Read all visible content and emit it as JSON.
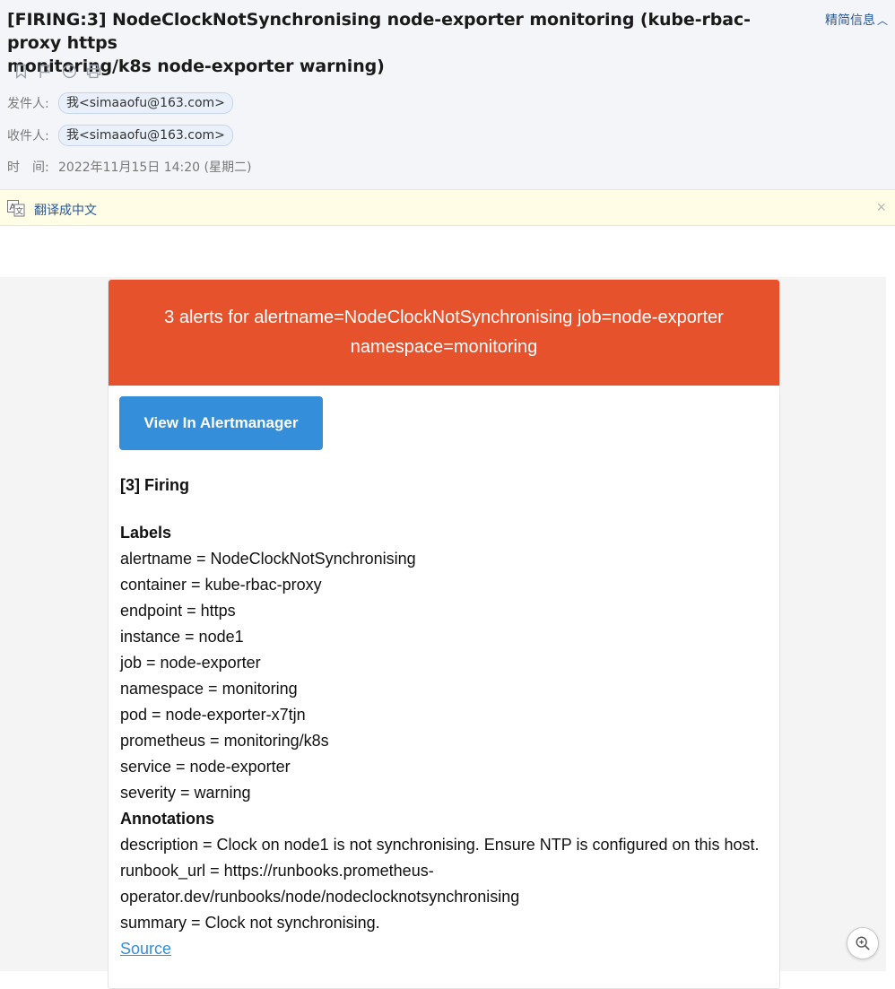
{
  "header": {
    "subject_line1": "[FIRING:3] NodeClockNotSynchronising node-exporter monitoring (kube-rbac-proxy https",
    "subject_line2": "monitoring/k8s node-exporter warning)",
    "brief_toggle": "精简信息",
    "toolbar_icons": [
      "bookmark-icon",
      "flag-icon",
      "clock-icon",
      "print-icon"
    ],
    "from_label": "发件人:",
    "from_addr": "我<simaaofu@163.com>",
    "to_label": "收件人:",
    "to_addr": "我<simaaofu@163.com>",
    "time_label": "时　间:",
    "time_value": "2022年11月15日 14:20 (星期二)"
  },
  "translate": {
    "link": "翻译成中文",
    "close": "×"
  },
  "alert": {
    "banner_line1": "3 alerts for alertname=NodeClockNotSynchronising job=node-exporter",
    "banner_line2": "namespace=monitoring",
    "banner_color": "#e6522c",
    "button_label": "View In Alertmanager",
    "button_color": "#348eda",
    "firing": "[3] Firing",
    "labels_heading": "Labels",
    "labels": [
      "alertname = NodeClockNotSynchronising",
      "container = kube-rbac-proxy",
      "endpoint = https",
      "instance = node1",
      "job = node-exporter",
      "namespace = monitoring",
      "pod = node-exporter-x7tjn",
      "prometheus = monitoring/k8s",
      "service = node-exporter",
      "severity = warning"
    ],
    "annotations_heading": "Annotations",
    "annotations": [
      "description = Clock on node1 is not synchronising. Ensure NTP is configured on this host.",
      "runbook_url = https://runbooks.prometheus-",
      "operator.dev/runbooks/node/nodeclocknotsynchronising",
      "summary = Clock not synchronising."
    ],
    "source_link": "Source"
  },
  "zoom_icon": "zoom-in-icon"
}
